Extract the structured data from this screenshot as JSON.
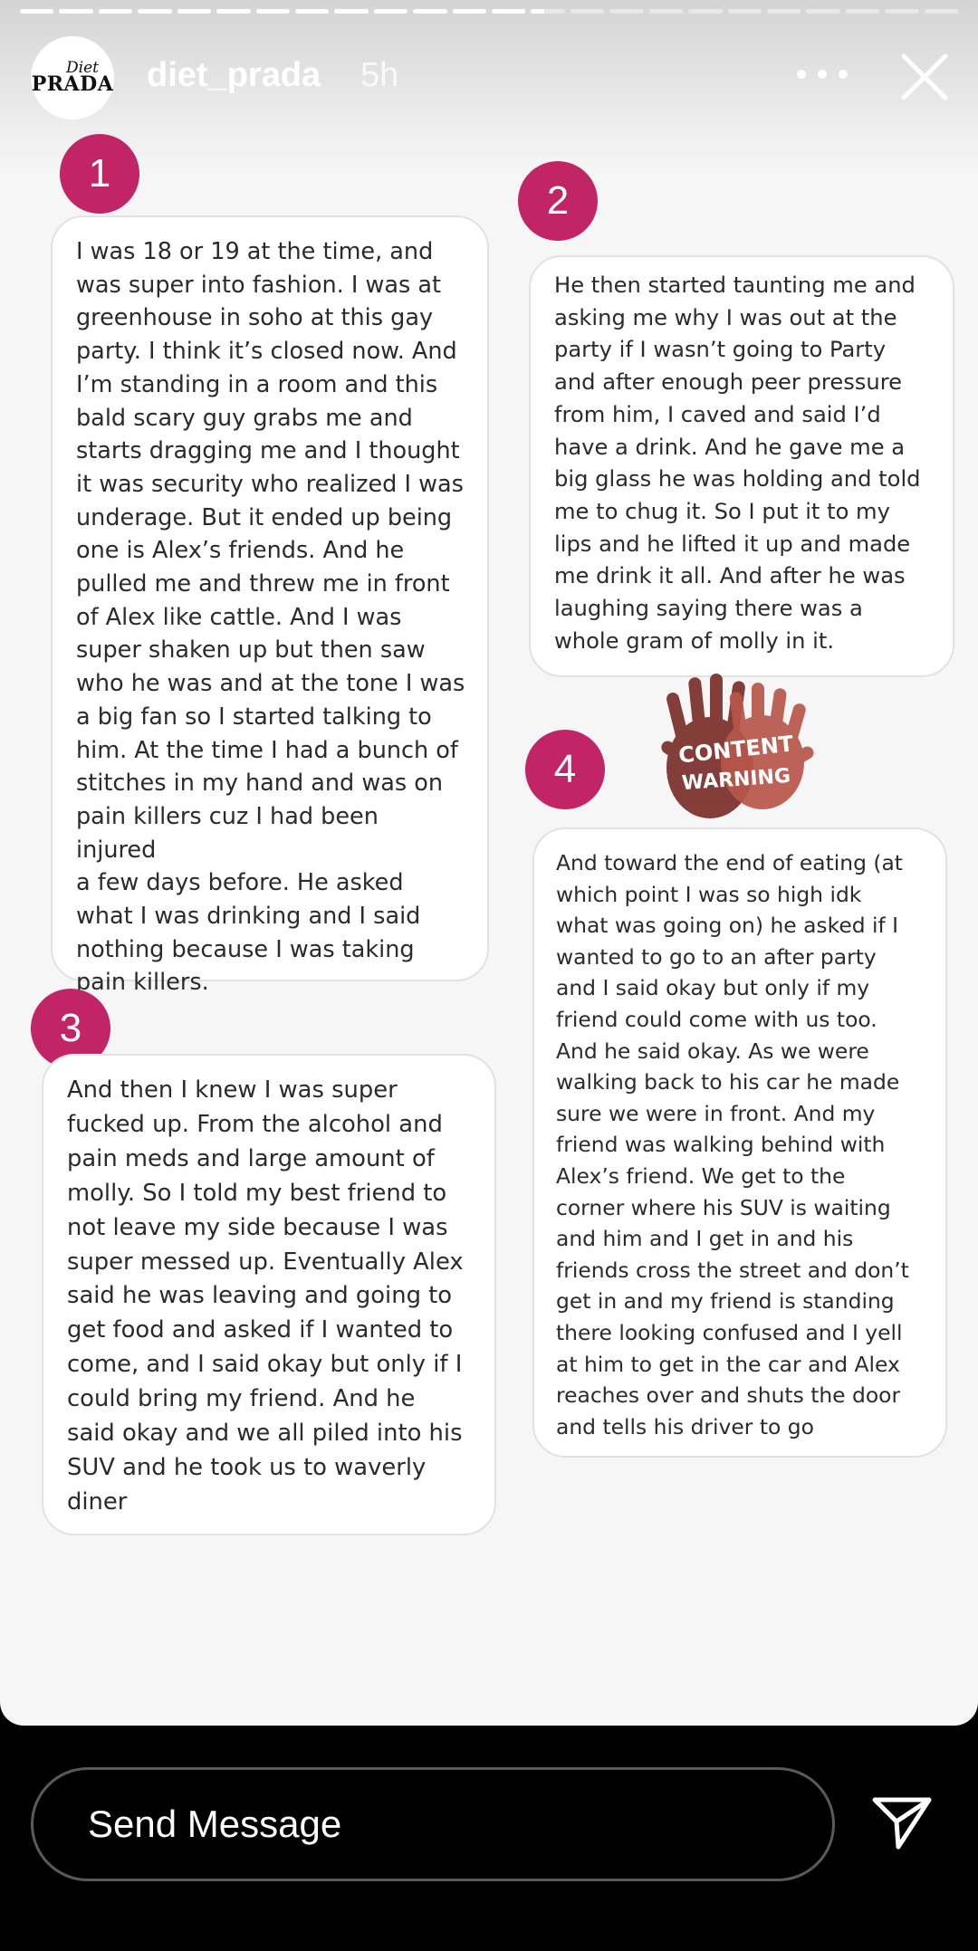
{
  "story": {
    "progress": {
      "total_segments": 24,
      "completed_segments": 13
    },
    "header": {
      "avatar": {
        "logo_top": "Diet",
        "logo_main": "PRADA"
      },
      "username": "diet_prada",
      "time": "5h",
      "more_icon": "more-horizontal-icon",
      "close_icon": "close-x-icon"
    },
    "cards": [
      {
        "number": "1",
        "text": "I was 18 or 19 at the time, and\nwas super into fashion. I was at\ngreenhouse in soho at this gay\nparty. I think it’s closed now. And\nI’m standing in a room and this\nbald scary guy grabs me and\nstarts dragging me and I thought\nit was security who realized I was\nunderage. But it ended up being\none is Alex’s friends. And he\npulled me and threw me in front\nof Alex like cattle. And I was\nsuper shaken up but then saw\nwho he was and at the tone I was\na big fan so I started talking to\nhim. At the time I had a bunch of\nstitches in my hand and was on\npain killers cuz I had been injured\na few days before. He asked\nwhat I was drinking and I said\nnothing because I was taking\npain killers."
      },
      {
        "number": "2",
        "text": "He then started taunting me and\nasking me why I was out at the\nparty if I wasn’t going to Party\nand after enough peer pressure\nfrom him, I caved and said I’d\nhave a drink. And he gave me a\nbig glass he was holding and told\nme to chug it. So I put it to my\nlips and he lifted it up and made\nme drink it all. And after he was\nlaughing saying there was a\nwhole gram of molly in it."
      },
      {
        "number": "3",
        "text": "And then I knew I was super\nfucked up. From the alcohol and\npain meds and large amount of\nmolly. So I told my best friend to\nnot leave my side because I was\nsuper messed up. Eventually Alex\nsaid he was leaving and going to\nget food and asked if I wanted to\ncome, and I said okay but only if I\ncould bring my friend. And he\nsaid okay and we all piled into his\nSUV and he took us to waverly\ndiner"
      },
      {
        "number": "4",
        "text": "And toward the end of eating (at\nwhich point I was so high idk\nwhat was going on) he asked if I\nwanted to go to an after party\nand I said okay but only if my\nfriend could come with us too.\nAnd he said okay. As we were\nwalking back to his car he made\nsure we were in front. And my\nfriend was walking behind with\nAlex’s friend. We get to the\ncorner where his SUV is waiting\nand him and I get in and his\nfriends cross the street and don’t\nget in and my friend is standing\nthere looking confused and I yell\nat him to get in the car and Alex\nreaches over and shuts the door\nand tells his driver to go"
      }
    ],
    "content_warning": {
      "line1": "CONTENT",
      "line2": "WARNING"
    },
    "colors": {
      "badge": "#c12566",
      "warning_hand_dark": "#7a2f2a",
      "warning_hand_light": "#b8564a"
    }
  },
  "message_bar": {
    "placeholder": "Send Message",
    "send_icon": "paper-plane-send-icon"
  }
}
